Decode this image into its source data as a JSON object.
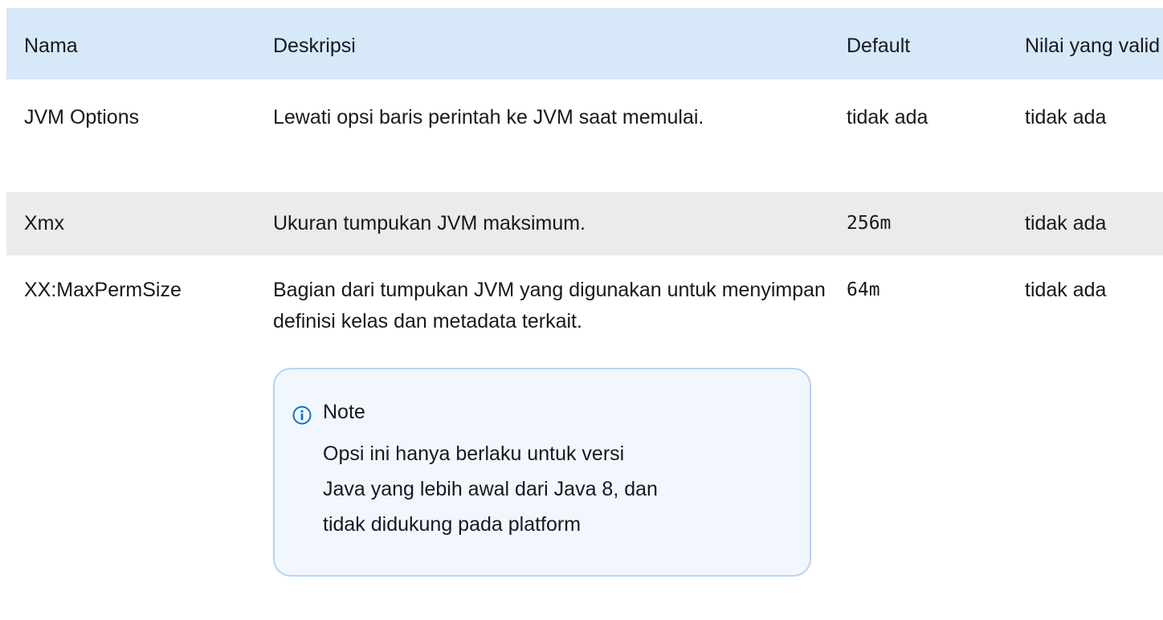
{
  "table": {
    "headers": {
      "name": "Nama",
      "description": "Deskripsi",
      "default": "Default",
      "valid": "Nilai yang valid"
    },
    "rows": [
      {
        "name": "JVM Options",
        "description": "Lewati opsi baris perintah ke JVM saat memulai.",
        "default": "tidak ada",
        "valid": "tidak ada"
      },
      {
        "name": "Xmx",
        "description": "Ukuran tumpukan JVM maksimum.",
        "default": "256m",
        "valid": "tidak ada"
      },
      {
        "name": "XX:MaxPermSize",
        "description": "Bagian dari tumpukan JVM yang digunakan untuk menyimpan definisi kelas dan metadata terkait.",
        "default": "64m",
        "valid": "tidak ada",
        "note": {
          "icon": "info-icon",
          "title": "Note",
          "body": "Opsi ini hanya berlaku untuk versi Java yang lebih awal dari Java 8, dan tidak didukung pada platform"
        }
      }
    ]
  },
  "colors": {
    "header_bg": "#d7e8f8",
    "striped_row_bg": "#ebebeb",
    "note_border": "#b7d3ee",
    "note_bg": "#f1f7fd",
    "info_icon": "#0972d3"
  }
}
